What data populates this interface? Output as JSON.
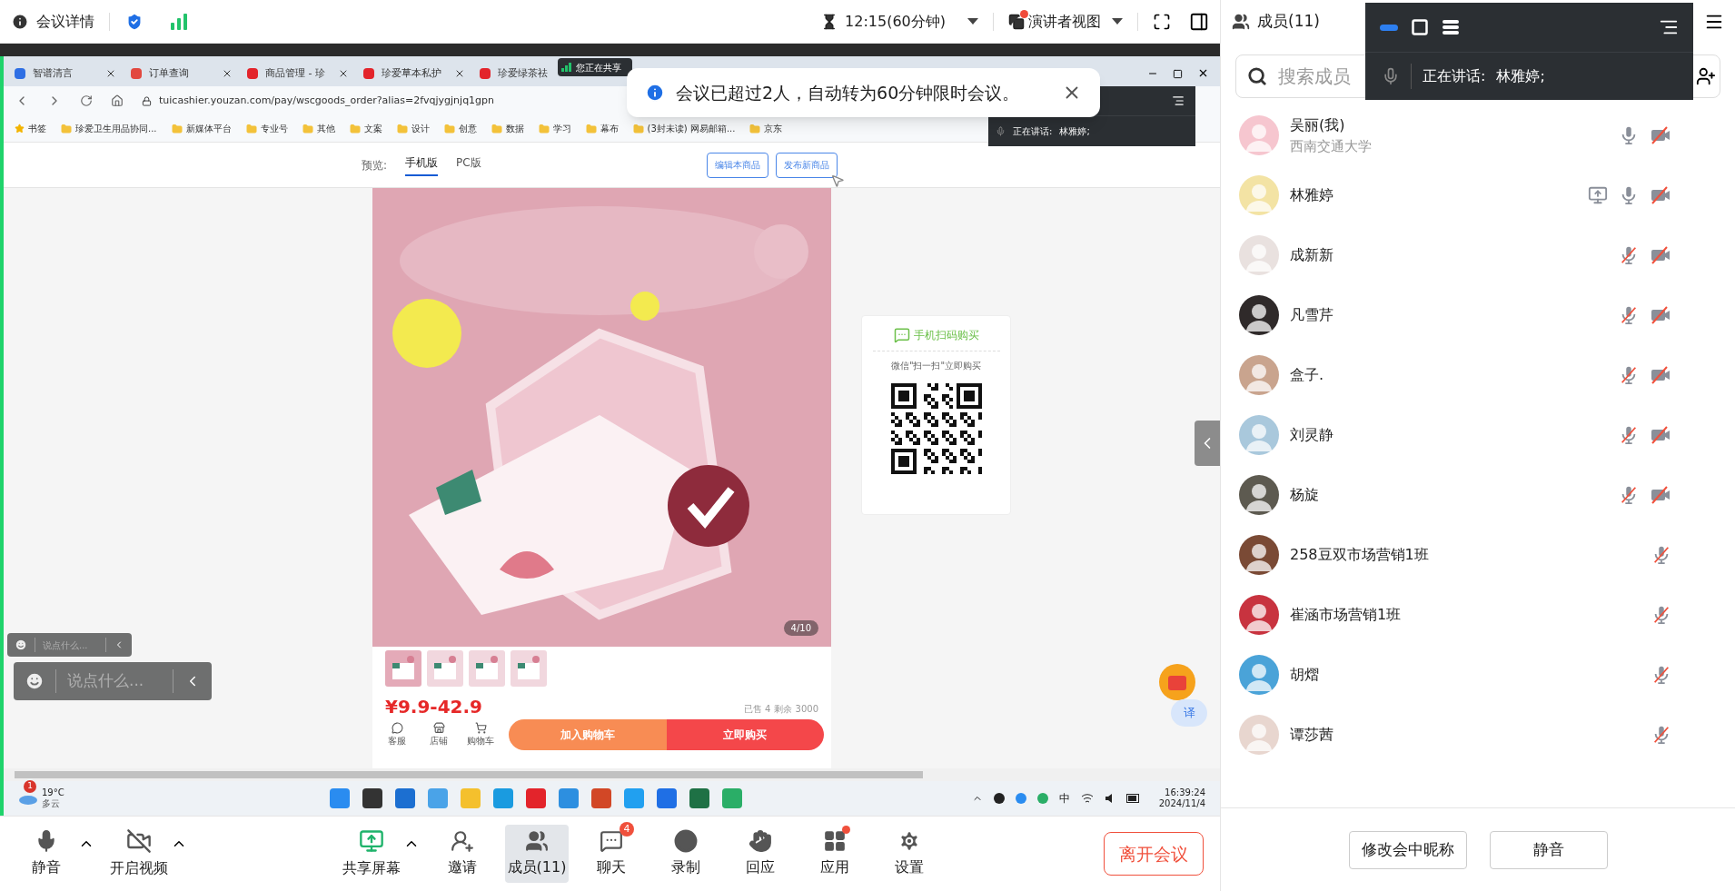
{
  "top_bar": {
    "title": "会议详情",
    "timer": "12:15(60分钟)",
    "view": "演讲者视图",
    "view_dot": true
  },
  "speaker_panel": {
    "label": "正在讲话:",
    "name": "林雅婷;"
  },
  "members_panel": {
    "title": "成员(11)",
    "search_placeholder": "搜索成员",
    "members": [
      {
        "name": "吴丽(我)",
        "subtitle": "西南交通大学",
        "sharing": false,
        "muted": false,
        "camera_off": true,
        "color": "#f6c6cf"
      },
      {
        "name": "林雅婷",
        "sharing": true,
        "muted": false,
        "camera_off": true,
        "color": "#f3e3a4"
      },
      {
        "name": "成新新",
        "sharing": false,
        "muted": true,
        "camera_off": true,
        "color": "#e9e1df"
      },
      {
        "name": "凡雪芹",
        "sharing": false,
        "muted": true,
        "camera_off": true,
        "color": "#2f2a2a"
      },
      {
        "name": "盒子.",
        "sharing": false,
        "muted": true,
        "camera_off": true,
        "color": "#c9a48e"
      },
      {
        "name": "刘灵静",
        "sharing": false,
        "muted": true,
        "camera_off": true,
        "color": "#a9c8dc"
      },
      {
        "name": "杨旋",
        "sharing": false,
        "muted": true,
        "camera_off": true,
        "color": "#5d5a50"
      },
      {
        "name": "258豆双市场营销1班",
        "sharing": false,
        "muted": true,
        "camera_off": false,
        "color": "#7a4a35"
      },
      {
        "name": "崔涵市场营销1班",
        "sharing": false,
        "muted": true,
        "camera_off": false,
        "color": "#c8333f"
      },
      {
        "name": "胡熠",
        "sharing": false,
        "muted": true,
        "camera_off": false,
        "color": "#4aa3d8"
      },
      {
        "name": "谭莎茜",
        "sharing": false,
        "muted": true,
        "camera_off": false,
        "color": "#e8d6cf"
      }
    ],
    "buttons": [
      "修改会中昵称",
      "静音"
    ]
  },
  "shared_screen": {
    "sharing_label": "您正在共享",
    "toast": "会议已超过2人，自动转为60分钟限时会议。",
    "browser": {
      "tabs": [
        "智谱清言",
        "订单查询",
        "商品管理 - 珍",
        "珍爱草本私护",
        "珍爱绿茶祛"
      ],
      "url": "tuicashier.youzan.com/pay/wscgoods_order?alias=2fvqjygjnjq1gpn",
      "bookmarks": [
        "书签",
        "珍爱卫生用品协同...",
        "新媒体平台",
        "专业号",
        "其他",
        "文案",
        "设计",
        "创意",
        "数据",
        "学习",
        "幕布",
        "(3封未读) 网易邮箱...",
        "京东"
      ],
      "mini_speaker": {
        "label": "正在讲话:",
        "name": "林雅婷;"
      }
    },
    "page": {
      "preview_label": "预览:",
      "preview_tabs": [
        {
          "label": "手机版",
          "selected": true
        },
        {
          "label": "PC版",
          "selected": false
        }
      ],
      "actions": [
        "编辑本商品",
        "发布新商品"
      ],
      "image_counter": "4/10",
      "price": "¥9.9-42.9",
      "sold": "已售 4",
      "stock": "剩余 3000",
      "nav": [
        "客服",
        "店铺",
        "购物车"
      ],
      "cart_button": "加入购物车",
      "buy_button": "立即购买",
      "qr_title": "手机扫码购买",
      "qr_hint": "微信\"扫一扫\"立即购买",
      "translate": "译"
    },
    "chat_inputs": [
      {
        "placeholder": "说点什么..."
      },
      {
        "placeholder": "说点什么..."
      }
    ],
    "taskbar": {
      "temp": "19°C",
      "weather": "多云",
      "weather_badge": "1",
      "ime": "中",
      "time": "16:39:24",
      "date": "2024/11/4"
    }
  },
  "toolbar": {
    "items": [
      {
        "kind": "mic",
        "label": "静音",
        "caret": true,
        "selected": false
      },
      {
        "kind": "video",
        "label": "开启视频",
        "caret": true,
        "selected": false
      },
      {
        "kind": "share",
        "label": "共享屏幕",
        "caret": true,
        "selected": false
      },
      {
        "kind": "invite",
        "label": "邀请",
        "caret": false,
        "selected": false
      },
      {
        "kind": "members",
        "label": "成员(11)",
        "caret": false,
        "selected": true
      },
      {
        "kind": "chat",
        "label": "聊天",
        "caret": false,
        "selected": false,
        "badge": "4"
      },
      {
        "kind": "record",
        "label": "录制",
        "caret": false,
        "selected": false
      },
      {
        "kind": "react",
        "label": "回应",
        "caret": false,
        "selected": false
      },
      {
        "kind": "apps",
        "label": "应用",
        "caret": false,
        "selected": false,
        "dot": true
      },
      {
        "kind": "settings",
        "label": "设置",
        "caret": false,
        "selected": false
      }
    ],
    "leave": "离开会议"
  }
}
